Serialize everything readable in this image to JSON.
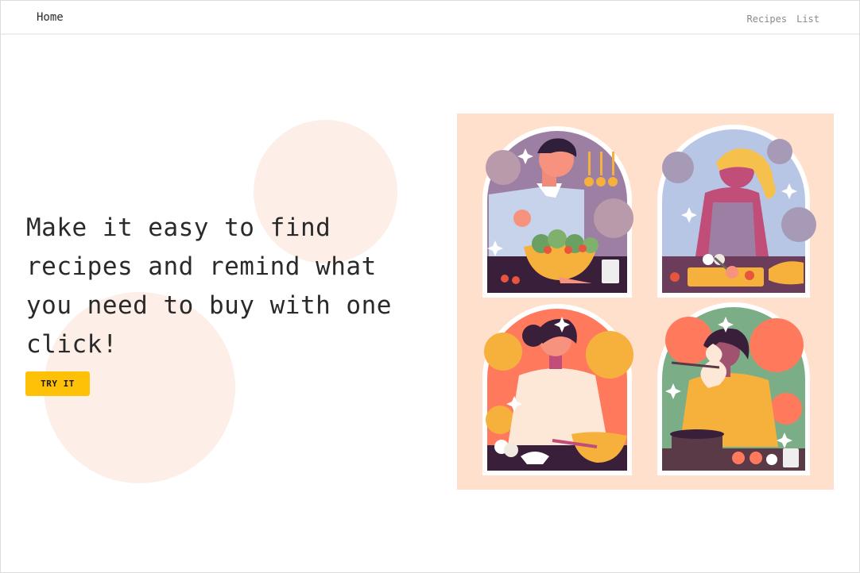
{
  "nav": {
    "brand": "Home",
    "links": [
      "Recipes",
      "List"
    ]
  },
  "hero": {
    "headline": "Make it easy to find recipes and remind what you need to buy with one click!",
    "cta_label": "TRY IT"
  },
  "colors": {
    "accent": "#ffc107",
    "blob": "#fdeee7",
    "illustration_bg": "#ffe0cc"
  }
}
